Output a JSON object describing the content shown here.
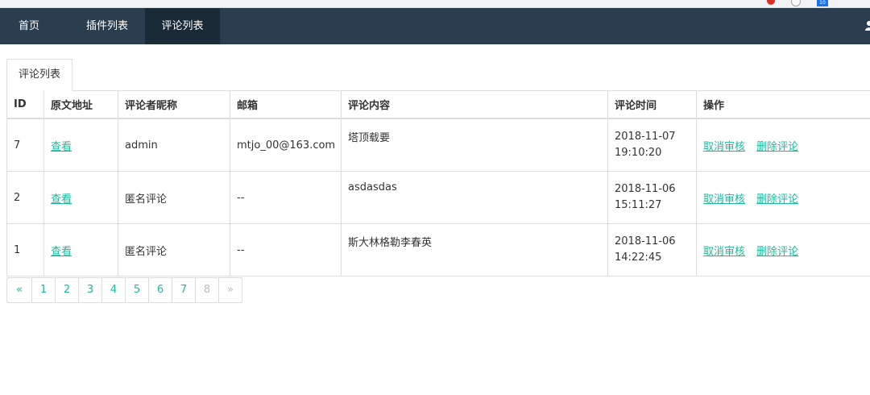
{
  "nav": {
    "items": [
      {
        "label": "首页",
        "active": false
      },
      {
        "label": "插件列表",
        "active": false
      },
      {
        "label": "评论列表",
        "active": true
      }
    ]
  },
  "tab": {
    "label": "评论列表"
  },
  "table": {
    "headers": [
      "ID",
      "原文地址",
      "评论者昵称",
      "邮箱",
      "评论内容",
      "评论时间",
      "操作"
    ],
    "rows": [
      {
        "id": "7",
        "link": "查看",
        "nickname": "admin",
        "email": "mtjo_00@163.com",
        "content": "塔顶载要",
        "date": "2018-11-07",
        "time": "19:10:20",
        "op1": "取消审核",
        "op2": "删除评论"
      },
      {
        "id": "2",
        "link": "查看",
        "nickname": "匿名评论",
        "email": "--",
        "content": "asdasdas",
        "date": "2018-11-06",
        "time": "15:11:27",
        "op1": "取消审核",
        "op2": "删除评论"
      },
      {
        "id": "1",
        "link": "查看",
        "nickname": "匿名评论",
        "email": "--",
        "content": "斯大林格勒李春英",
        "date": "2018-11-06",
        "time": "14:22:45",
        "op1": "取消审核",
        "op2": "删除评论"
      }
    ]
  },
  "pagination": {
    "prev": "«",
    "pages": [
      "1",
      "2",
      "3",
      "4",
      "5",
      "6",
      "7",
      "8"
    ],
    "current": "8",
    "next": "»"
  },
  "browser": {
    "badge": "10"
  },
  "colors": {
    "nav_bg": "#2b3e50",
    "nav_active": "#1b2a37",
    "link": "#18bc9c"
  }
}
